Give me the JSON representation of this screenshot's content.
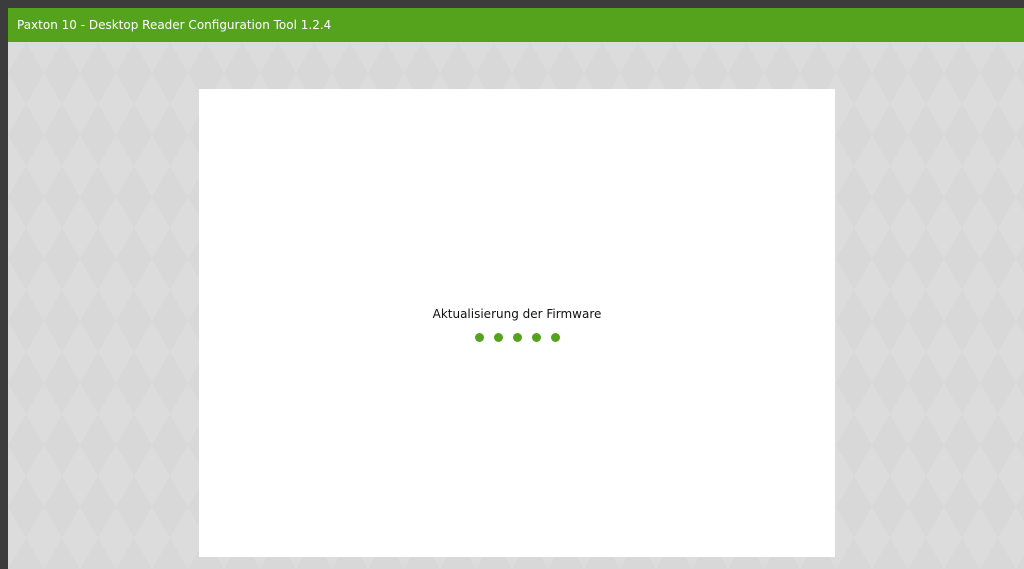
{
  "window": {
    "title": "Paxton 10 - Desktop Reader Configuration Tool 1.2.4"
  },
  "main": {
    "status_text": "Aktualisierung der Firmware",
    "loading_dots": 5
  },
  "colors": {
    "accent": "#55a31d",
    "frame": "#3c3c3c",
    "backdrop": "#d8d8d8",
    "panel": "#ffffff"
  },
  "icons": {
    "loading": "loading-dots-icon"
  }
}
